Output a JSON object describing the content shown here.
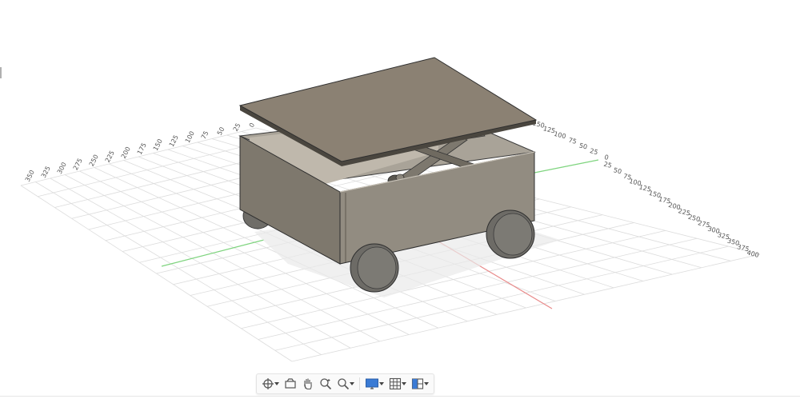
{
  "ruler_left": {
    "labels": [
      "350",
      "325",
      "300",
      "275",
      "250",
      "225",
      "200",
      "175",
      "150",
      "125",
      "100",
      "75",
      "50",
      "25",
      "0"
    ]
  },
  "ruler_right_upper": {
    "labels": [
      "150",
      "125",
      "100",
      "75",
      "50",
      "25",
      "0"
    ]
  },
  "ruler_right_lower": {
    "labels": [
      "25",
      "50",
      "75",
      "100",
      "125",
      "150",
      "175",
      "200",
      "225",
      "250",
      "275",
      "300",
      "325",
      "350",
      "375",
      "400"
    ]
  },
  "colors": {
    "grid_line": "#dcdcdc",
    "axis_x": "#e88a8a",
    "axis_y": "#7fd47f",
    "body": "#8a8478",
    "lid": "#8b8173",
    "wheel": "#6d6b66"
  },
  "toolbar": {
    "items": [
      {
        "name": "orbit-icon",
        "has_caret": true
      },
      {
        "name": "look-at-icon",
        "has_caret": false
      },
      {
        "name": "pan-icon",
        "has_caret": false
      },
      {
        "name": "zoom-icon",
        "has_caret": false
      },
      {
        "name": "fit-icon",
        "has_caret": true
      },
      {
        "name": "display-settings-icon",
        "has_caret": true
      },
      {
        "name": "grid-snap-icon",
        "has_caret": true
      },
      {
        "name": "viewports-icon",
        "has_caret": true
      }
    ]
  }
}
